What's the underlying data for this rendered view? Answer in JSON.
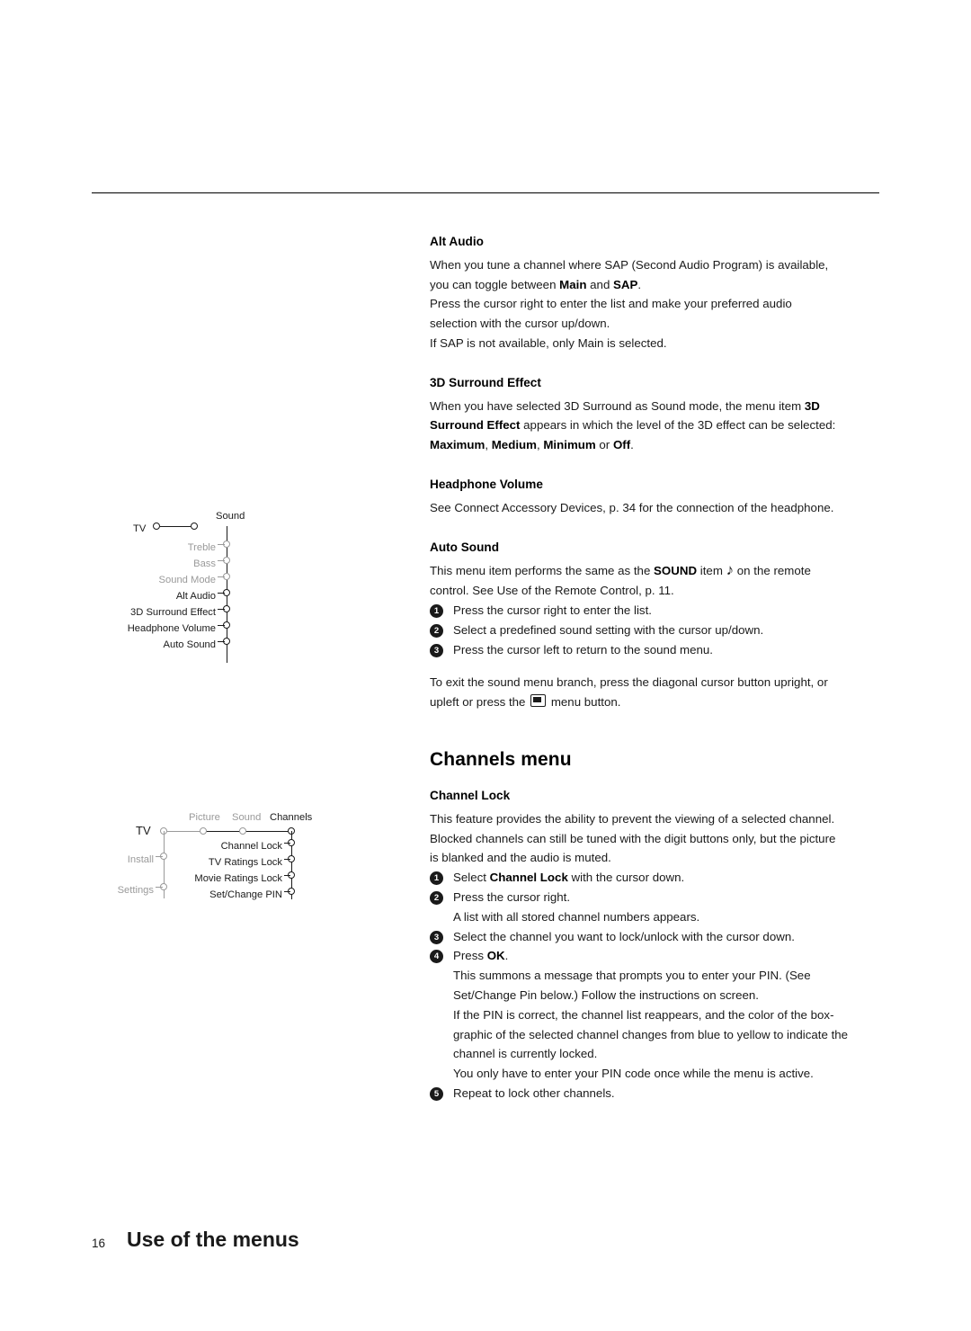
{
  "page": {
    "number": "16",
    "footer_title": "Use of the menus"
  },
  "sound_section": {
    "alt_audio": {
      "heading": "Alt Audio",
      "p1": "When you tune a channel where SAP (Second Audio Program) is available,",
      "p2_pre": "you can toggle between ",
      "p2_b1": "Main",
      "p2_mid": " and ",
      "p2_b2": "SAP",
      "p2_post": ".",
      "p3": "Press the cursor right to enter the list and make your preferred audio",
      "p4": "selection with the cursor up/down.",
      "p5": "If SAP is not available, only Main is selected."
    },
    "surround": {
      "heading": "3D Surround Effect",
      "p1_pre": "When you have selected 3D Surround as Sound mode, the menu item ",
      "p1_b": "3D",
      "p2_b": "Surround Effect",
      "p2_post": " appears in which the level of the 3D effect can be selected:",
      "p3_b1": "Maximum",
      "p3_sep1": ", ",
      "p3_b2": "Medium",
      "p3_sep2": ", ",
      "p3_b3": "Minimum",
      "p3_mid": " or ",
      "p3_b4": "Off",
      "p3_post": "."
    },
    "headphone": {
      "heading": "Headphone Volume",
      "p1": "See Connect Accessory Devices, p. 34 for the connection of the headphone."
    },
    "auto_sound": {
      "heading": "Auto Sound",
      "p1_pre": "This menu item performs the same as the ",
      "p1_b": "SOUND",
      "p1_mid": " item ",
      "p1_icon": "♪",
      "p1_post": " on the remote",
      "p2": "control. See Use of the Remote Control, p. 11.",
      "steps": [
        {
          "n": "1",
          "text": "Press the cursor right to enter the list."
        },
        {
          "n": "2",
          "text": "Select a predefined sound setting with the cursor up/down."
        },
        {
          "n": "3",
          "text": "Press the cursor left to return to the sound menu."
        }
      ],
      "exit_p1": "To exit the sound menu branch, press the diagonal cursor button upright, or",
      "exit_p2_pre": "upleft or press the ",
      "exit_p2_icon": "menu-button-icon",
      "exit_p2_post": " menu button."
    }
  },
  "channels_section": {
    "title": "Channels menu",
    "channel_lock": {
      "heading": "Channel Lock",
      "p1": "This feature provides the ability to prevent the viewing of a selected channel.",
      "p2": "Blocked channels can still be tuned with the digit buttons only, but the picture",
      "p3": "is blanked and the audio is muted.",
      "step1_pre": "Select ",
      "step1_b": "Channel Lock",
      "step1_post": " with the cursor down.",
      "step2a": "Press the cursor right.",
      "step2b": "A list with all stored channel numbers appears.",
      "step3": "Select the channel you want to lock/unlock with the cursor down.",
      "step4_pre": "Press ",
      "step4_b": "OK",
      "step4_post": ".",
      "step4_l1": "This summons a message that prompts you to enter your PIN. (See",
      "step4_l2": "Set/Change Pin below.) Follow the instructions on screen.",
      "step4_l3": "If the PIN is correct, the channel list reappears, and the color of the box-",
      "step4_l4": "graphic of the selected channel changes from blue to yellow to indicate the",
      "step4_l5": "channel is currently locked.",
      "step4_l6": "You only have to enter your PIN code once while the menu is active.",
      "step5": "Repeat to lock other channels.",
      "nums": {
        "n1": "1",
        "n2": "2",
        "n3": "3",
        "n4": "4",
        "n5": "5"
      }
    }
  },
  "sound_diagram": {
    "root": "TV",
    "branch": "Sound",
    "items": [
      {
        "label": "Treble",
        "gray": true
      },
      {
        "label": "Bass",
        "gray": true
      },
      {
        "label": "Sound Mode",
        "gray": true
      },
      {
        "label": "Alt Audio",
        "gray": false
      },
      {
        "label": "3D Surround Effect",
        "gray": false
      },
      {
        "label": "Headphone Volume",
        "gray": false
      },
      {
        "label": "Auto Sound",
        "gray": false
      }
    ]
  },
  "channels_diagram": {
    "root": "TV",
    "top_branches": [
      {
        "label": "Picture",
        "gray": true
      },
      {
        "label": "Sound",
        "gray": true
      },
      {
        "label": "Channels",
        "gray": false
      }
    ],
    "left_branches": [
      {
        "label": "Install",
        "gray": true
      },
      {
        "label": "Settings",
        "gray": true
      }
    ],
    "items": [
      {
        "label": "Channel Lock"
      },
      {
        "label": "TV Ratings Lock"
      },
      {
        "label": "Movie Ratings Lock"
      },
      {
        "label": "Set/Change PIN"
      }
    ]
  }
}
